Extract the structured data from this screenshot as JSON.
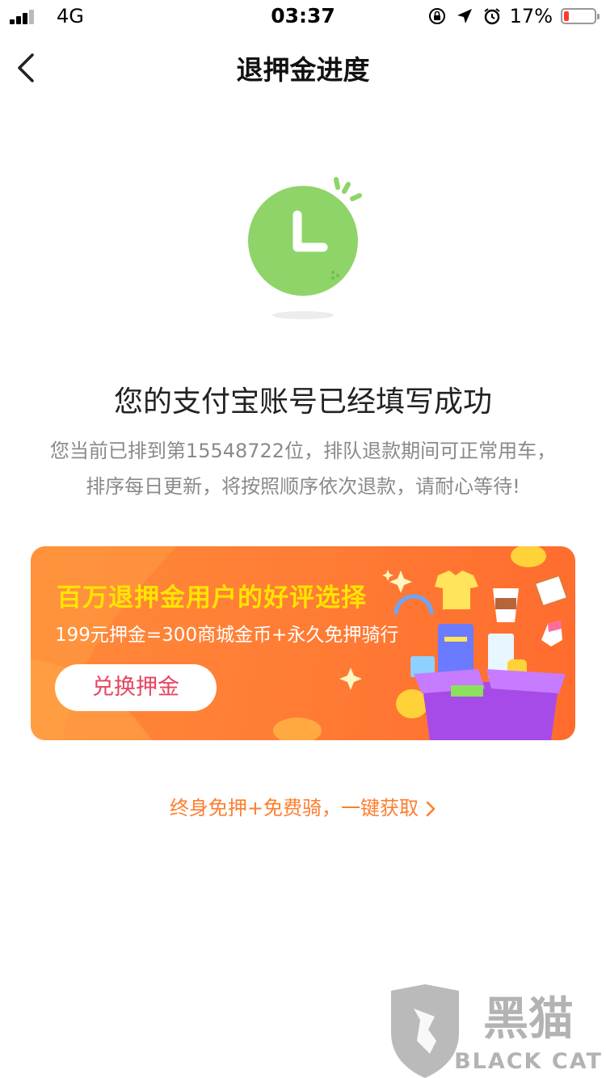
{
  "status_bar": {
    "carrier": "4G",
    "time": "03:37",
    "battery_percent_label": "17%",
    "battery_level": 0.17,
    "icons": [
      "signal-icon",
      "orientation-lock-icon",
      "location-arrow-icon",
      "alarm-icon",
      "battery-icon"
    ]
  },
  "nav": {
    "title": "退押金进度",
    "back_icon": "chevron-left-icon"
  },
  "illustration": {
    "icon": "clock-icon",
    "color": "#8ed468"
  },
  "result": {
    "headline": "您的支付宝账号已经填写成功",
    "description_line1": "您当前已排到第15548722位，排队退款期间可正常用车，",
    "description_line2": "排序每日更新，将按照顺序依次退款，请耐心等待!"
  },
  "banner": {
    "title": "百万退押金用户的好评选择",
    "subtitle": "199元押金=300商城金币+永久免押骑行",
    "button_label": "兑换押金",
    "colors": {
      "background": "#ff7b34",
      "title": "#ffe400",
      "button_text": "#e6445f"
    }
  },
  "promo_link": {
    "text": "终身免押+免费骑，一键获取",
    "color": "#ff7d2e"
  },
  "watermark": {
    "cn": "黑猫",
    "en": "BLACK CAT"
  }
}
